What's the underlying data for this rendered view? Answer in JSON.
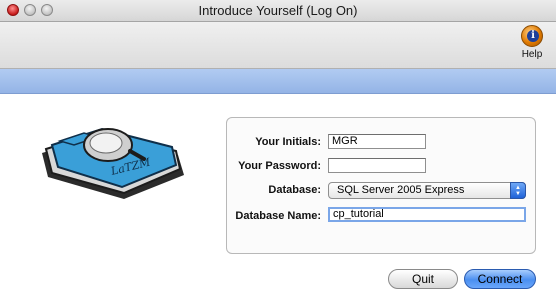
{
  "window": {
    "title": "Introduce Yourself (Log On)"
  },
  "toolbar": {
    "help_label": "Help"
  },
  "logo": {
    "text": "LaTZM"
  },
  "form": {
    "initials_label": "Your Initials:",
    "initials_value": "MGR",
    "password_label": "Your Password:",
    "password_value": "",
    "database_label": "Database:",
    "database_value": "SQL Server 2005 Express",
    "database_name_label": "Database Name:",
    "database_name_value": "cp_tutorial"
  },
  "buttons": {
    "quit": "Quit",
    "connect": "Connect"
  },
  "icons": {
    "help": "help-icon",
    "logo": "folder-logo-icon",
    "select_arrows": "select-arrows-icon"
  },
  "colors": {
    "accent_bar": "#9ab8e8",
    "connect_button": "#4b8ff0",
    "logo_folder": "#3a9fd8"
  }
}
